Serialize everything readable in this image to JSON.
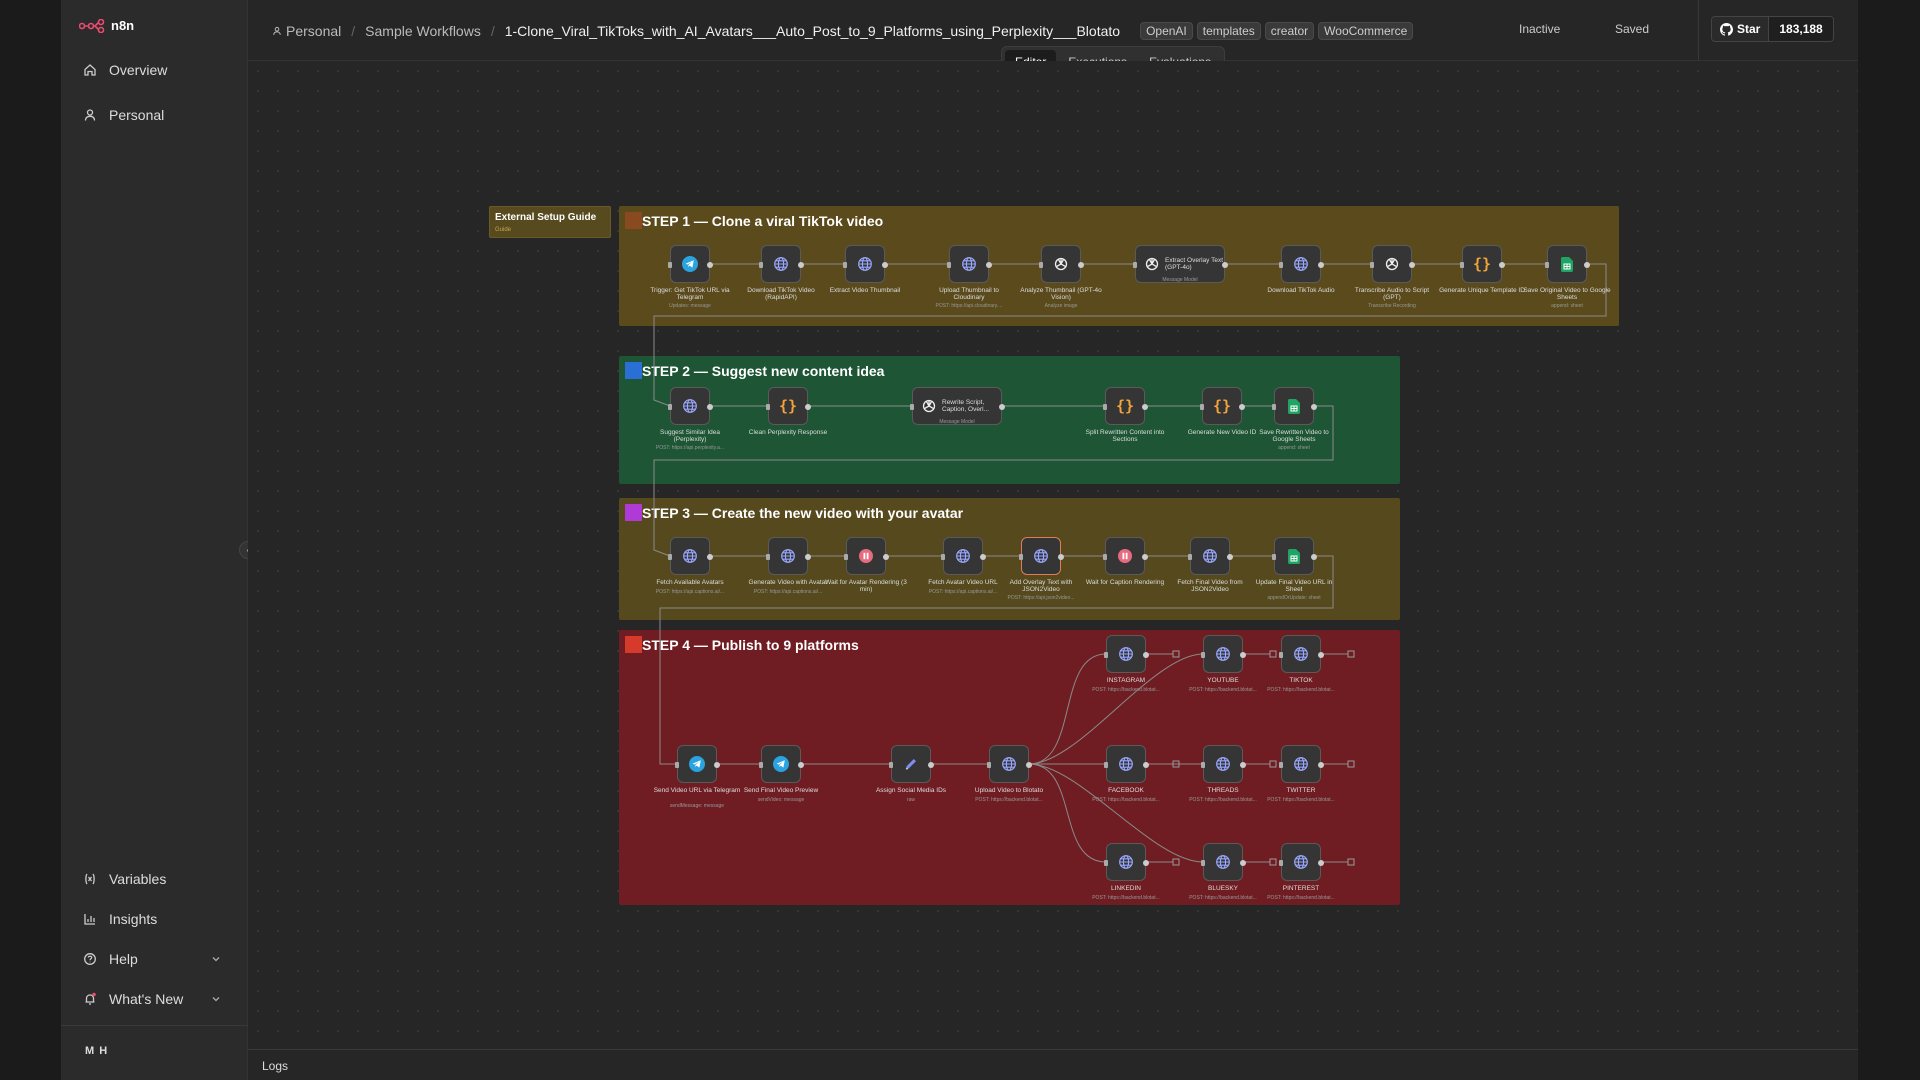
{
  "app": {
    "name": "n8n"
  },
  "sidebar": {
    "items": [
      {
        "label": "Overview",
        "icon": "home-icon"
      },
      {
        "label": "Personal",
        "icon": "user-icon"
      }
    ],
    "bottom_items": [
      {
        "label": "Variables",
        "icon": "variables-icon"
      },
      {
        "label": "Insights",
        "icon": "insights-icon"
      },
      {
        "label": "Help",
        "icon": "help-icon"
      },
      {
        "label": "What's New",
        "icon": "bell-icon"
      }
    ],
    "user_initials": "M H"
  },
  "header": {
    "breadcrumb": {
      "project": "Personal",
      "folder": "Sample Workflows",
      "workflow": "1-Clone_Viral_TikToks_with_AI_Avatars___Auto_Post_to_9_Platforms_using_Perplexity___Blotato"
    },
    "tags": [
      "OpenAI",
      "templates",
      "creator",
      "WooCommerce"
    ],
    "status": "Inactive",
    "save_state": "Saved",
    "github": {
      "label": "Star",
      "count": "183,188"
    },
    "tabs": [
      {
        "label": "Editor",
        "active": true
      },
      {
        "label": "Executions",
        "active": false
      },
      {
        "label": "Evaluations",
        "active": false
      }
    ]
  },
  "canvas": {
    "guide": {
      "title": "External Setup Guide",
      "subtitle": "Guide"
    },
    "steps": [
      {
        "title": "STEP 1 — Clone a viral TikTok video",
        "color": "#5a4a1c",
        "marker": "#8a4a20"
      },
      {
        "title": "STEP 2 — Suggest new content idea",
        "color": "#1d5535",
        "marker": "#2a6fd6"
      },
      {
        "title": "STEP 3 — Create the new video with your avatar",
        "color": "#55491d",
        "marker": "#b03ad6"
      },
      {
        "title": "STEP 4 — Publish to 9 platforms",
        "color": "#6f1d22",
        "marker": "#d63a2a"
      }
    ],
    "nodes": {
      "step1": [
        {
          "label": "Trigger: Get TikTok URL via Telegram",
          "sub": "Updates: message",
          "icon": "telegram-icon"
        },
        {
          "label": "Download TikTok Video (RapidAPI)",
          "sub": "",
          "icon": "globe-icon"
        },
        {
          "label": "Extract Video Thumbnail",
          "sub": "",
          "icon": "globe-icon"
        },
        {
          "label": "Upload Thumbnail to Cloudinary",
          "sub": "POST: https://api.cloudinary....",
          "icon": "globe-icon"
        },
        {
          "label": "Analyze Thumbnail (GPT-4o Vision)",
          "sub": "Analyze image",
          "icon": "openai-icon"
        },
        {
          "label": "Extract Overlay Text (GPT-4o)",
          "sub": "Message Model",
          "icon": "openai-icon"
        },
        {
          "label": "Download TikTok Audio",
          "sub": "",
          "icon": "globe-icon"
        },
        {
          "label": "Transcribe Audio to Script (GPT)",
          "sub": "Transcribe Recording",
          "icon": "openai-icon"
        },
        {
          "label": "Generate Unique Template ID",
          "sub": "",
          "icon": "code-icon"
        },
        {
          "label": "Save Original Video to Google Sheets",
          "sub": "append: sheet",
          "icon": "sheets-icon"
        }
      ],
      "step2": [
        {
          "label": "Suggest Similar Idea (Perplexity)",
          "sub": "POST: https://api.perplexity.a...",
          "icon": "globe-icon"
        },
        {
          "label": "Clean Perplexity Response",
          "sub": "",
          "icon": "code-icon"
        },
        {
          "label": "Rewrite Script, Caption, Overl...",
          "sub": "Message Model",
          "icon": "openai-icon"
        },
        {
          "label": "Split Rewritten Content into Sections",
          "sub": "",
          "icon": "code-icon"
        },
        {
          "label": "Generate New Video ID",
          "sub": "",
          "icon": "code-icon"
        },
        {
          "label": "Save Rewritten Video to Google Sheets",
          "sub": "append: sheet",
          "icon": "sheets-icon"
        }
      ],
      "step3": [
        {
          "label": "Fetch Available Avatars",
          "sub": "POST: https://api.captions.ai/...",
          "icon": "globe-icon"
        },
        {
          "label": "Generate Video with Avatar",
          "sub": "POST: https://api.captions.ai/...",
          "icon": "globe-icon"
        },
        {
          "label": "Wait for Avatar Rendering (3 min)",
          "sub": "",
          "icon": "pause-icon"
        },
        {
          "label": "Fetch Avatar Video URL",
          "sub": "POST: https://api.captions.ai/...",
          "icon": "globe-icon"
        },
        {
          "label": "Add Overlay Text with JSON2Video",
          "sub": "POST: https://api.json2video...",
          "icon": "globe-icon"
        },
        {
          "label": "Wait for Caption Rendering",
          "sub": "",
          "icon": "pause-icon"
        },
        {
          "label": "Fetch Final Video from JSON2Video",
          "sub": "",
          "icon": "globe-icon"
        },
        {
          "label": "Update Final Video URL in Sheet",
          "sub": "appendOrUpdate: sheet",
          "icon": "sheets-icon"
        }
      ],
      "step4_main": [
        {
          "label": "Send Video URL via Telegram",
          "sub": "sendMessage: message",
          "icon": "telegram-icon"
        },
        {
          "label": "Send Final Video Preview",
          "sub": "sendVideo: message",
          "icon": "telegram-icon"
        },
        {
          "label": "Assign Social Media IDs",
          "sub": "raw",
          "icon": "pencil-icon"
        },
        {
          "label": "Upload Video to Blotato",
          "sub": "POST: https://backend.blotat...",
          "icon": "globe-icon"
        }
      ],
      "step4_platforms": [
        {
          "label": "INSTAGRAM",
          "sub": "POST: https://backend.blotat..."
        },
        {
          "label": "YOUTUBE",
          "sub": "POST: https://backend.blotat..."
        },
        {
          "label": "TIKTOK",
          "sub": "POST: https://backend.blotat..."
        },
        {
          "label": "FACEBOOK",
          "sub": "POST: https://backend.blotat..."
        },
        {
          "label": "THREADS",
          "sub": "POST: https://backend.blotat..."
        },
        {
          "label": "TWITTER",
          "sub": "POST: https://backend.blotat..."
        },
        {
          "label": "LINKEDIN",
          "sub": "POST: https://backend.blotat..."
        },
        {
          "label": "BLUESKY",
          "sub": "POST: https://backend.blotat..."
        },
        {
          "label": "PINTEREST",
          "sub": "POST: https://backend.blotat..."
        }
      ]
    }
  },
  "logs": {
    "label": "Logs"
  }
}
